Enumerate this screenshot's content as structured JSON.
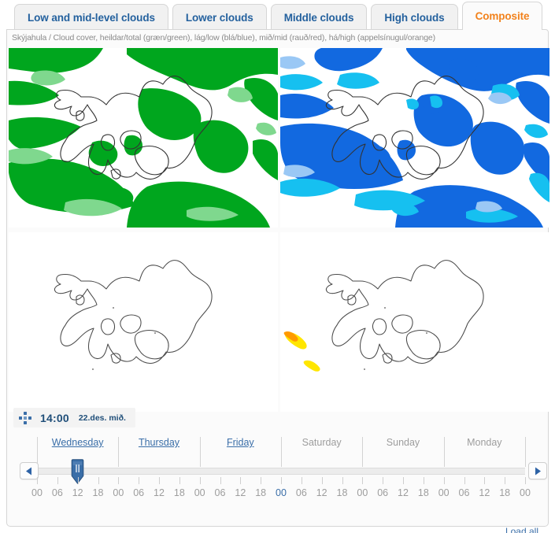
{
  "tabs": [
    {
      "label": "Low and mid-level clouds",
      "active": false
    },
    {
      "label": "Lower clouds",
      "active": false
    },
    {
      "label": "Middle clouds",
      "active": false
    },
    {
      "label": "High clouds",
      "active": false
    },
    {
      "label": "Composite",
      "active": true
    }
  ],
  "caption": "Skýjahula / Cloud cover, heildar/total (græn/green), lág/low (blá/blue), mið/mid (rauð/red), há/high (appelsínugul/orange)",
  "maps": [
    {
      "name": "total-cloud-cover-map",
      "legend": "heildar/total",
      "color": "#00a61e",
      "position": "top-left"
    },
    {
      "name": "low-cloud-cover-map",
      "legend": "lág/low",
      "color": "#1269e0",
      "position": "top-right"
    },
    {
      "name": "mid-cloud-cover-map",
      "legend": "mið/mid",
      "color": "#e01010",
      "position": "bottom-left"
    },
    {
      "name": "high-cloud-cover-map",
      "legend": "há/high",
      "color": "#ffb300",
      "position": "bottom-right"
    }
  ],
  "time": {
    "move_icon": "move-crosshair-icon",
    "clock": "14:00",
    "date": "22.des. mið."
  },
  "timeline": {
    "days": [
      {
        "label": "Wednesday",
        "enabled": true
      },
      {
        "label": "Thursday",
        "enabled": true
      },
      {
        "label": "Friday",
        "enabled": true
      },
      {
        "label": "Saturday",
        "enabled": false
      },
      {
        "label": "Sunday",
        "enabled": false
      },
      {
        "label": "Monday",
        "enabled": false
      }
    ],
    "hours": [
      "00",
      "06",
      "12",
      "18",
      "00",
      "06",
      "12",
      "18",
      "00",
      "06",
      "12",
      "18",
      "00",
      "06",
      "12",
      "18",
      "00",
      "06",
      "12",
      "18",
      "00",
      "06",
      "12",
      "18",
      "00"
    ],
    "highlighted_hour_index": 12,
    "selected_hour_index": 2,
    "prev_button": "previous-arrow-icon",
    "next_button": "next-arrow-icon",
    "load_all_label": "Load all"
  },
  "colors": {
    "accent_active_tab": "#f2821c",
    "tab_text": "#24619e",
    "link": "#3a6ea8",
    "disabled": "#9d9d9d",
    "panel_bg": "#fbfbfb",
    "panel_border": "#d6d6d6",
    "total_green": "#00a61e",
    "low_blue": "#1269e0",
    "high_orange": "#ffb300"
  }
}
